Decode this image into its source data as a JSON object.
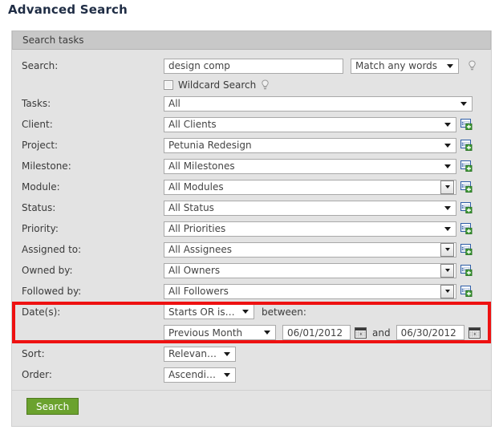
{
  "page": {
    "title": "Advanced Search"
  },
  "panel": {
    "header": "Search tasks"
  },
  "search_row": {
    "label": "Search:",
    "query_value": "design comp",
    "query_placeholder": "",
    "match_mode": "Match any words",
    "hint_icon": "lightbulb-icon"
  },
  "wildcard": {
    "label": "Wildcard Search",
    "checked": false,
    "hint_icon": "lightbulb-icon"
  },
  "fields": [
    {
      "label": "Tasks:",
      "value": "All",
      "style": "flat",
      "add": false,
      "hint": false
    },
    {
      "label": "Client:",
      "value": "All Clients",
      "style": "flat",
      "add": true,
      "hint": false
    },
    {
      "label": "Project:",
      "value": "Petunia Redesign",
      "style": "flat",
      "add": true,
      "hint": true
    },
    {
      "label": "Milestone:",
      "value": "All Milestones",
      "style": "flat",
      "add": true,
      "hint": false
    },
    {
      "label": "Module:",
      "value": "All Modules",
      "style": "boxed",
      "add": true,
      "hint": false
    },
    {
      "label": "Status:",
      "value": "All Status",
      "style": "flat",
      "add": true,
      "hint": false
    },
    {
      "label": "Priority:",
      "value": "All Priorities",
      "style": "flat",
      "add": true,
      "hint": false
    },
    {
      "label": "Assigned to:",
      "value": "All Assignees",
      "style": "boxed",
      "add": true,
      "hint": false
    },
    {
      "label": "Owned by:",
      "value": "All Owners",
      "style": "boxed",
      "add": true,
      "hint": false
    },
    {
      "label": "Followed by:",
      "value": "All Followers",
      "style": "boxed",
      "add": true,
      "hint": false
    }
  ],
  "dates": {
    "label": "Date(s):",
    "condition": "Starts OR is due",
    "between_label": "between:",
    "range_preset": "Previous Month",
    "from_date": "06/01/2012",
    "to_date": "06/30/2012",
    "and_label": "and",
    "calendar_icon": "calendar-icon",
    "highlight_color": "#ee1111"
  },
  "sort": {
    "label": "Sort:",
    "value": "Relevance"
  },
  "order": {
    "label": "Order:",
    "value": "Ascending"
  },
  "footer": {
    "search_button": "Search",
    "button_color": "#6ba22e"
  }
}
